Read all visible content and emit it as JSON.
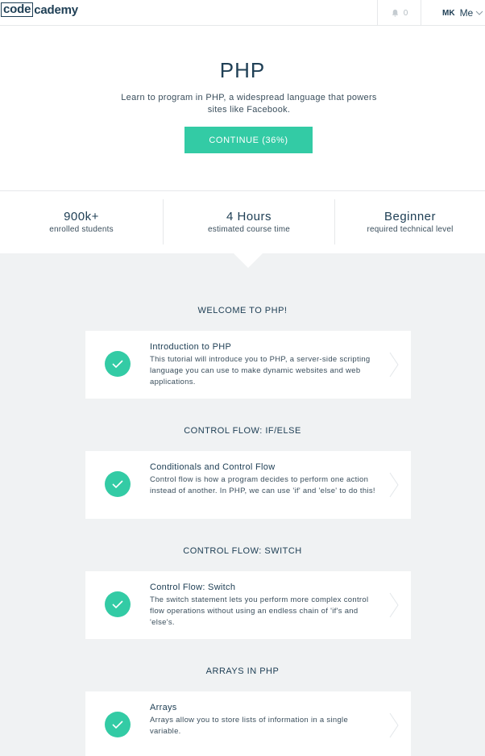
{
  "header": {
    "logo": {
      "boxed": "code",
      "rest": "cademy"
    },
    "notifications_count": "0",
    "user_initials": "MK",
    "user_menu_label": "Me"
  },
  "hero": {
    "title": "PHP",
    "description": "Learn to program in PHP, a widespread language that powers sites like Facebook.",
    "continue_label": "CONTINUE (36%)",
    "progress_percent": 36
  },
  "stats": [
    {
      "value": "900k+",
      "label": "enrolled students"
    },
    {
      "value": "4 Hours",
      "label": "estimated course time"
    },
    {
      "value": "Beginner",
      "label": "required technical level"
    }
  ],
  "sections": [
    {
      "title": "WELCOME TO PHP!",
      "lesson": {
        "title": "Introduction to PHP",
        "description": "This tutorial will introduce you to PHP, a server-side scripting language you can use to make dynamic websites and web applications.",
        "completed": true
      }
    },
    {
      "title": "CONTROL FLOW: IF/ELSE",
      "lesson": {
        "title": "Conditionals and Control Flow",
        "description": "Control flow is how a program decides to perform one action instead of another. In PHP, we can use 'if' and 'else' to do this!",
        "completed": true
      }
    },
    {
      "title": "CONTROL FLOW: SWITCH",
      "lesson": {
        "title": "Control Flow: Switch",
        "description": "The switch statement lets you perform more complex control flow operations without using an endless chain of 'if's and 'else's.",
        "completed": true
      }
    },
    {
      "title": "ARRAYS IN PHP",
      "lesson": {
        "title": "Arrays",
        "description": "Arrays allow you to store lists of information in a single variable.",
        "completed": true
      }
    }
  ],
  "icons": {
    "notification": "bell-icon",
    "user_menu": "chevron-down-icon",
    "lesson_status": "check-icon",
    "lesson_open": "chevron-right-icon"
  },
  "colors": {
    "accent": "#33cba5",
    "text": "#204056",
    "background": "#f0f2f3"
  }
}
